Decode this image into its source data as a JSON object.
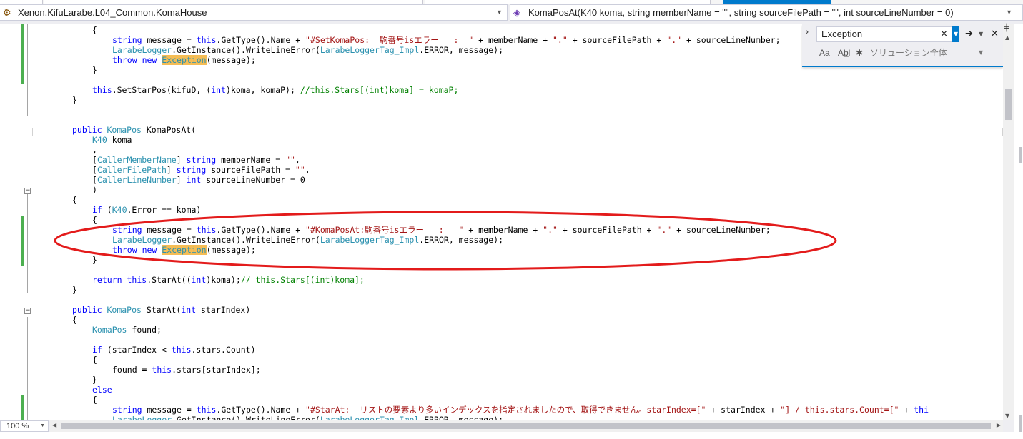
{
  "navbar": {
    "left_combo": {
      "icon": "project-icon",
      "text": "Xenon.KifuLarabe.L04_Common.KomaHouse"
    },
    "right_combo": {
      "icon": "method-cube-icon",
      "text": "KomaPosAt(K40 koma, string memberName = \"\", string sourceFilePath = \"\", int sourceLineNumber = 0)"
    }
  },
  "find_widget": {
    "search_value": "Exception",
    "clear_glyph": "×",
    "find_next_glyph": "➔",
    "close_glyph": "✕",
    "match_case_label": "Aa",
    "whole_word_label": "Ab̲l",
    "regex_glyph": "✱",
    "scope_label": "ソリューション全体"
  },
  "code": {
    "l01": "if (K40.Error == koma)",
    "l02": "{",
    "l03": {
      "a": "string",
      "b": " message = ",
      "c": "this",
      "d": ".GetType().Name + ",
      "e": "\"#SetKomaPos:  駒番号isエラー   :  \"",
      "f": " + memberName + ",
      "g": "\".\"",
      "h": " + sourceFilePath + ",
      "i": "\".\"",
      "j": " + sourceLineNumber;"
    },
    "l04": {
      "a": "LarabeLogger",
      "b": ".GetInstance().WriteLineError(",
      "c": "LarabeLoggerTag_Impl",
      "d": ".ERROR, message);"
    },
    "l05": {
      "a": "throw",
      "b": " ",
      "c": "new",
      "d": " ",
      "e": "Exception",
      "f": "(message);"
    },
    "l06": "}",
    "l07": {
      "a": "this",
      "b": ".SetStarPos(kifuD, (",
      "c": "int",
      "d": ")koma, komaP); ",
      "e": "//this.Stars[(int)koma] = komaP;"
    },
    "l08": "}",
    "l09": {
      "a": "public",
      "b": " ",
      "c": "KomaPos",
      "d": " KomaPosAt("
    },
    "l10": {
      "a": "K40",
      "b": " koma"
    },
    "l11": ",",
    "l12": {
      "a": "[",
      "b": "CallerMemberName",
      "c": "] ",
      "d": "string",
      "e": " memberName = ",
      "f": "\"\"",
      "g": ","
    },
    "l13": {
      "a": "[",
      "b": "CallerFilePath",
      "c": "] ",
      "d": "string",
      "e": " sourceFilePath = ",
      "f": "\"\"",
      "g": ","
    },
    "l14": {
      "a": "[",
      "b": "CallerLineNumber",
      "c": "] ",
      "d": "int",
      "e": " sourceLineNumber = 0"
    },
    "l15": ")",
    "l16": "{",
    "l17": {
      "a": "if",
      "b": " (",
      "c": "K40",
      "d": ".Error == koma)"
    },
    "l18": "{",
    "l19": {
      "a": "string",
      "b": " message = ",
      "c": "this",
      "d": ".GetType().Name + ",
      "e": "\"#KomaPosAt:駒番号isエラー   :   \"",
      "f": " + memberName + ",
      "g": "\".\"",
      "h": " + sourceFilePath + ",
      "i": "\".\"",
      "j": " + sourceLineNumber;"
    },
    "l20": {
      "a": "LarabeLogger",
      "b": ".GetInstance().WriteLineError(",
      "c": "LarabeLoggerTag_Impl",
      "d": ".ERROR, message);"
    },
    "l21": {
      "a": "throw",
      "b": " ",
      "c": "new",
      "d": " ",
      "e": "Exception",
      "f": "(message);"
    },
    "l22": "}",
    "l23": {
      "a": "return",
      "b": " ",
      "c": "this",
      "d": ".StarAt((",
      "e": "int",
      "f": ")koma);",
      "g": "// this.Stars[(int)koma];"
    },
    "l24": "}",
    "l25": {
      "a": "public",
      "b": " ",
      "c": "KomaPos",
      "d": " StarAt(",
      "e": "int",
      "f": " starIndex)"
    },
    "l26": "{",
    "l27": {
      "a": "KomaPos",
      "b": " found;"
    },
    "l28": {
      "a": "if",
      "b": " (starIndex < ",
      "c": "this",
      "d": ".stars.Count)"
    },
    "l29": "{",
    "l30": {
      "a": "found = ",
      "b": "this",
      "c": ".stars[starIndex];"
    },
    "l31": "}",
    "l32": "else",
    "l33": "{",
    "l34": {
      "a": "string",
      "b": " message = ",
      "c": "this",
      "d": ".GetType().Name + ",
      "e": "\"#StarAt:  リストの要素より多いインデックスを指定されましたので、取得できません。starIndex=[\"",
      "f": " + starIndex + ",
      "g": "\"] / this.stars.Count=[\"",
      "h": " + ",
      "i": "thi"
    },
    "l35": {
      "a": "LarabeLogger",
      "b": ".GetInstance().WriteLineError(",
      "c": "LarabeLoggerTag_Impl",
      "d": ".ERROR, message);"
    }
  },
  "statusbar": {
    "zoom": "100 %"
  },
  "icons": {
    "collapse_box": "collapse-minus-icon",
    "split": "split-window-icon"
  }
}
